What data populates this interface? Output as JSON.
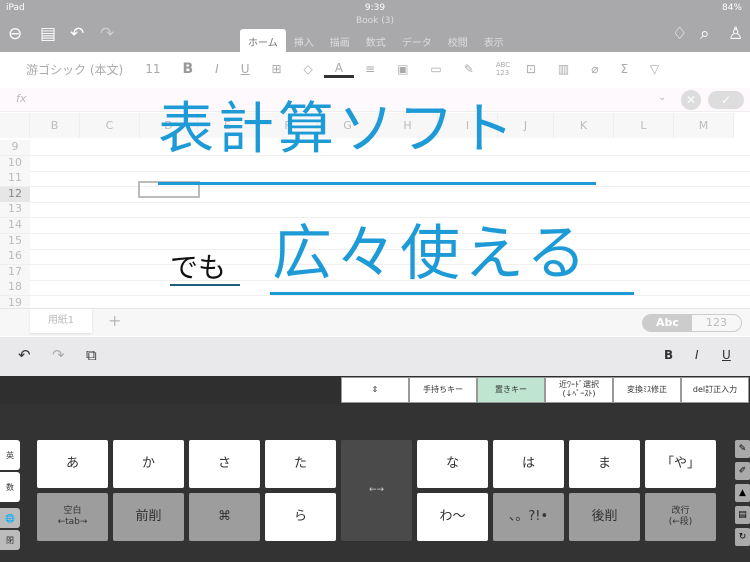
{
  "status": {
    "device": "iPad",
    "time": "9:39",
    "doc": "Book (3)",
    "battery": "84%"
  },
  "ribbon_tabs": [
    "ホーム",
    "挿入",
    "描画",
    "数式",
    "データ",
    "校閲",
    "表示"
  ],
  "ribbon": {
    "font": "游ゴシック (本文)",
    "size": "11",
    "bold": "B",
    "italic": "I",
    "underline": "U",
    "color": "A",
    "abc": "ABC 123",
    "sum": "Σ"
  },
  "formula": {
    "fx": "fx"
  },
  "columns": [
    "B",
    "C",
    "D",
    "E",
    "F",
    "G",
    "H",
    "I",
    "J",
    "K",
    "L",
    "M"
  ],
  "rows": [
    "9",
    "10",
    "11",
    "12",
    "13",
    "14",
    "15",
    "16",
    "17",
    "18",
    "19"
  ],
  "sheets": {
    "tab": "用紙1",
    "add": "+",
    "abc": "Abc",
    "num": "123"
  },
  "headline": {
    "line1": "表計算ソフト",
    "small": "でも",
    "line2": "広々使える"
  },
  "toolbar": {
    "undo": "↶",
    "redo": "↷",
    "copy": "⧉",
    "bold": "B",
    "italic": "I",
    "underline": "U"
  },
  "kb_top": [
    {
      "label": "⇕"
    },
    {
      "label": "手持ちキー"
    },
    {
      "label": "置きキー",
      "active": true
    },
    {
      "label": "近ﾜｰﾄﾞ選択\n(↓ﾍﾟｰｽﾄ)"
    },
    {
      "label": "変換ﾐｽ修正"
    },
    {
      "label": "del訂正入力"
    }
  ],
  "side_keys": [
    "英",
    "数",
    "🌐",
    "閉"
  ],
  "row1_left": [
    "あ",
    "か",
    "さ",
    "た"
  ],
  "row1_right": [
    "な",
    "は",
    "ま",
    "「や」"
  ],
  "row2_left": [
    "空白\n←tab→",
    "前削",
    "⌘",
    "ら"
  ],
  "row2_right": [
    "わ～",
    "、。?!•",
    "後削",
    "改行\n(←段)"
  ],
  "center_key": "←→",
  "accent": "#1e9bd7"
}
